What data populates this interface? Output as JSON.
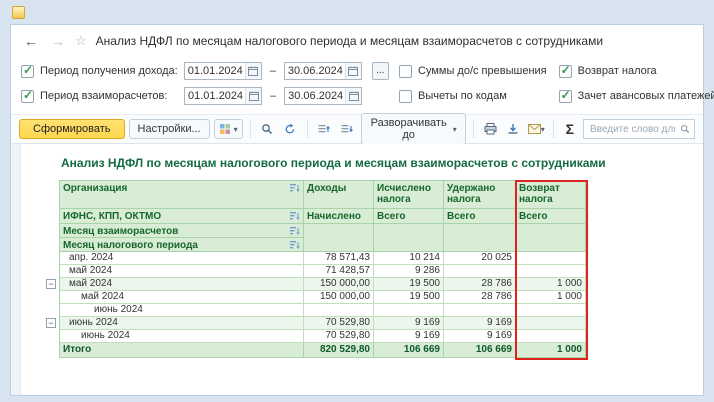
{
  "window": {
    "title": "Анализ НДФЛ по месяцам налогового периода и месяцам взаиморасчетов с сотрудниками"
  },
  "icons": {
    "back": "←",
    "forward": "→",
    "star": "☆",
    "caret": "▾",
    "expander_collapse": "−"
  },
  "filters": {
    "dash": "–",
    "more_label": "...",
    "income_period": {
      "label": "Период получения дохода:",
      "checked": true,
      "from": "01.01.2024",
      "to": "30.06.2024"
    },
    "settlement_period": {
      "label": "Период взаиморасчетов:",
      "checked": true,
      "from": "01.01.2024",
      "to": "30.06.2024"
    },
    "excess_sums": {
      "label": "Суммы до/с превышения",
      "checked": false
    },
    "deductions_by_codes": {
      "label": "Вычеты по кодам",
      "checked": false
    },
    "tax_return": {
      "label": "Возврат налога",
      "checked": true
    },
    "advance_offset": {
      "label": "Зачет авансовых платежей",
      "checked": true
    }
  },
  "toolbar": {
    "generate": "Сформировать",
    "settings": "Настройки...",
    "expand_to": "Разворачивать до",
    "sigma": "Σ",
    "search_placeholder": "Введите слово для фи..."
  },
  "report": {
    "title": "Анализ НДФЛ по месяцам налогового периода и месяцам взаиморасчетов с сотрудниками",
    "columns": {
      "org_rows": [
        "Организация",
        "ИФНС, КПП, ОКТМО",
        "Месяц взаиморасчетов",
        "Месяц налогового периода"
      ],
      "cols": [
        {
          "title": "Доходы",
          "sub": "Начислено"
        },
        {
          "title": "Исчислено налога",
          "sub": "Всего"
        },
        {
          "title": "Удержано налога",
          "sub": "Всего"
        },
        {
          "title": "Возврат налога",
          "sub": "Всего"
        }
      ]
    },
    "rows": [
      {
        "label": "апр. 2024",
        "group": false,
        "values": [
          "78 571,43",
          "10 214",
          "20 025",
          ""
        ]
      },
      {
        "label": "май 2024",
        "group": false,
        "values": [
          "71 428,57",
          "9 286",
          "",
          ""
        ]
      },
      {
        "label": "май 2024",
        "group": true,
        "values": [
          "150 000,00",
          "19 500",
          "28 786",
          "1 000"
        ]
      },
      {
        "label": "май 2024",
        "group": false,
        "values": [
          "150 000,00",
          "19 500",
          "28 786",
          "1 000"
        ]
      },
      {
        "label": "июнь 2024",
        "group": false,
        "values": [
          "",
          "",
          "",
          ""
        ]
      },
      {
        "label": "июнь 2024",
        "group": true,
        "values": [
          "70 529,80",
          "9 169",
          "9 169",
          ""
        ]
      },
      {
        "label": "июнь 2024",
        "group": false,
        "values": [
          "70 529,80",
          "9 169",
          "9 169",
          ""
        ]
      }
    ],
    "total": {
      "label": "Итого",
      "values": [
        "820 529,80",
        "106 669",
        "106 669",
        "1 000"
      ]
    }
  },
  "colors": {
    "generate_button": "#ffd64f",
    "header_bg": "#d8ecd6",
    "header_text": "#17672c",
    "group_row_bg": "#ecf6ec",
    "highlight_border": "#df221b",
    "check_green": "#2e9e4f"
  }
}
